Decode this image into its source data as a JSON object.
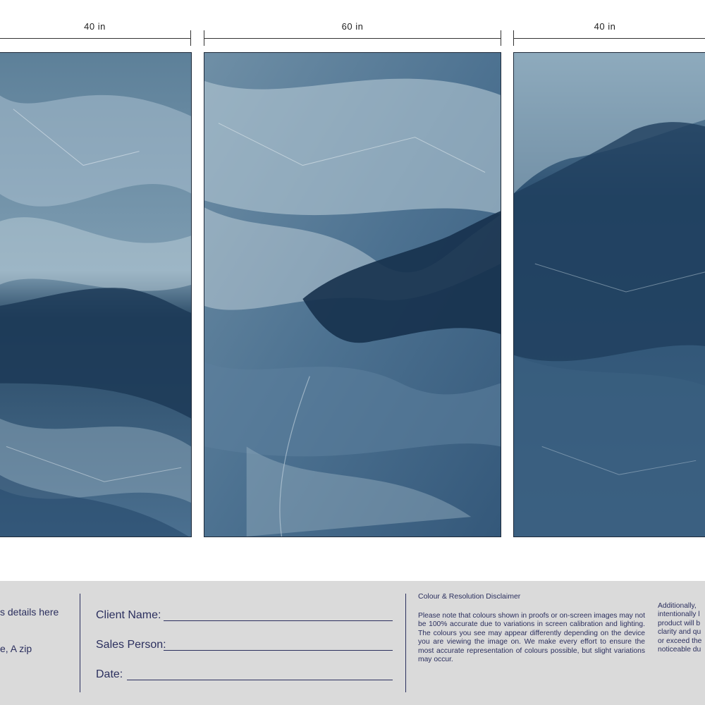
{
  "dimensions": [
    {
      "label": "40 in"
    },
    {
      "label": "60 in"
    },
    {
      "label": "40 in"
    }
  ],
  "panels": [
    {
      "name": "left-panel"
    },
    {
      "name": "center-panel"
    },
    {
      "name": "right-panel"
    }
  ],
  "colors": {
    "marble_dark": "#1c3a57",
    "marble_mid": "#43698a",
    "marble_light": "#a9c0cf",
    "footer_bg": "#dadada",
    "footer_text": "#2b2f5e"
  },
  "footer": {
    "left_line1": "s details here",
    "left_line2": "e, A zip",
    "client_name_label": "Client Name:",
    "sales_person_label": "Sales Person:",
    "date_label": "Date:",
    "disclaimer_title": "Colour & Resolution Disclaimer",
    "disclaimer_body": "Please note that colours shown in proofs or on-screen images may not be 100% accurate due to variations in screen calibration and lighting. The colours you see may appear differently depending on the device you are viewing the image on. We make every effort to ensure the most accurate representation of colours possible, but slight variations may occur.",
    "extra_lines": [
      "Additionally,",
      "intentionally l",
      "product will b",
      "clarity and qu",
      "or exceed the",
      "noticeable du"
    ]
  }
}
